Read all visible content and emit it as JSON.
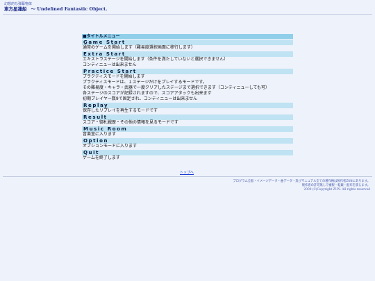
{
  "header": {
    "subtitle": "幻想的な弾幕物体",
    "title_jp": "東方星蓮船",
    "title_en": "〜 Undefined Fantastic Object."
  },
  "menu": {
    "heading": "■タイトルメニュー",
    "items": [
      {
        "name": "Game Start",
        "desc": [
          "通常のゲームを開始します（難易度選択画面に移行します）"
        ]
      },
      {
        "name": "Extra Start",
        "desc": [
          "エキストラステージを開始します（条件を満たしていないと選択できません）",
          "コンティニューは出来ません"
        ]
      },
      {
        "name": "Practice Start",
        "desc": [
          "プラクティスモードを開始します",
          "プラクティスモードは、１ステージだけをプレイするモードです。",
          "その難易度・キャラ・武器で一度クリアしたステージまで選択できます（コンティニューしても可）",
          "各ステージのスコアが記録されますので、スコアアタックも出来ます",
          "初期プレイヤー数9で固定され、コンティニューは出来ません"
        ]
      },
      {
        "name": "Replay",
        "desc": [
          "保存したリプレイを再生するモードです"
        ]
      },
      {
        "name": "Result",
        "desc": [
          "スコア・御札戦歴・その他の情報を見るモードです"
        ]
      },
      {
        "name": "Music Room",
        "desc": [
          "音楽室に入ります"
        ]
      },
      {
        "name": "Option",
        "desc": [
          "オプションモードに入ります"
        ]
      },
      {
        "name": "Quit",
        "desc": [
          "ゲームを終了します"
        ]
      }
    ]
  },
  "top_link": "トップへ",
  "footer": {
    "line1": "プログラム全般・イメージデータ・曲データ・及びマニュアル全ての著作権は製作者ZUNにあります。",
    "line2": "製作者の許可無しで複製・転載・配布を禁じます。",
    "copyright": "2009 (C)Copyright ZUN. All rights reserved"
  }
}
